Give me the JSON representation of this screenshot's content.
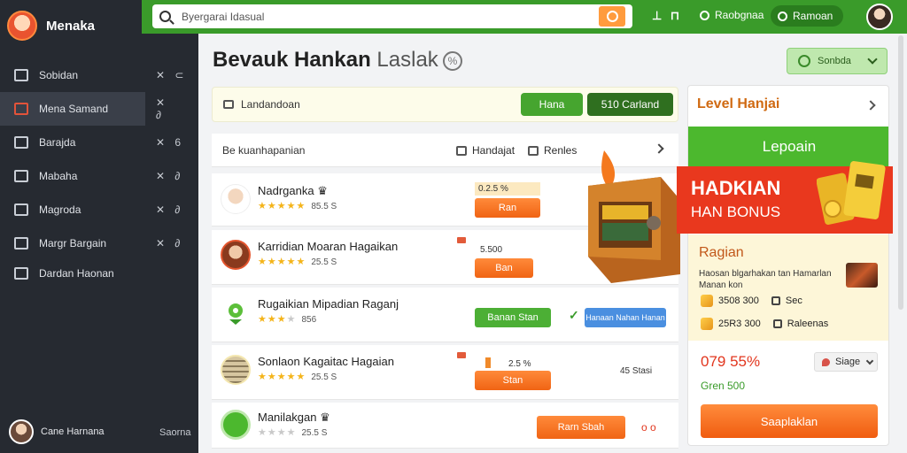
{
  "app": {
    "name": "Menaka"
  },
  "sidebar": {
    "items": [
      {
        "label": "Sobidan",
        "meta": "✕ ⊂",
        "active": false
      },
      {
        "label": "Mena Samand",
        "meta": "✕ ∂",
        "active": true
      },
      {
        "label": "Barajda",
        "meta": "✕ 6",
        "active": false
      },
      {
        "label": "Mabaha",
        "meta": "✕ ∂",
        "active": false
      },
      {
        "label": "Magroda",
        "meta": "✕ ∂",
        "active": false
      },
      {
        "label": "Margr Bargain",
        "meta": "✕ ∂",
        "active": false
      },
      {
        "label": "Dardan Haonan",
        "meta": "",
        "active": false
      }
    ],
    "user": {
      "name": "Cane Harnana",
      "meta": "Saorna"
    }
  },
  "topbar": {
    "search_value": "Byergarai Idasual",
    "mini": "⊥ ⊓",
    "link": "Raobgnaa",
    "pill": "Ramoan"
  },
  "main": {
    "title": "Bevauk Hankan",
    "title_suffix": "Laslak",
    "sort_label": "Sonbda",
    "filter_text": "Landandoan",
    "filter_btn1": "Hana",
    "filter_btn2": "510 Carland",
    "list_head": "Be kuanhapanian",
    "list_opt1": "Handajat",
    "list_opt2": "Renles",
    "rows": [
      {
        "name": "Nadrganka ♛",
        "score": "85.5 S",
        "pct": "0.2.5 %",
        "btn": "Ran"
      },
      {
        "name": "Karridian Moaran Hagaikan",
        "score": "25.5 S",
        "pct": "5.500",
        "btn": "Ban"
      },
      {
        "name": "Rugaikian Mipadian Raganj",
        "score": "856",
        "btn": "Banan Stan",
        "btn2": "Hanaan Nahan Hanan"
      },
      {
        "name": "Sonlaon Kagaitac Hagaian",
        "score": "25.5 S",
        "pct": "2.5 %",
        "btn": "Stan",
        "extra": "45 Stasi"
      },
      {
        "name": "Manilakgan ♛",
        "score": "25.5 S",
        "btn": "Rarn Sbah",
        "extra": "o o"
      }
    ]
  },
  "panel": {
    "title": "Level Hanjai",
    "green_label": "Lepoain",
    "bonus_line1": "HADKIAN",
    "bonus_line2": "HAN BONUS",
    "sub_title": "Ragian",
    "desc": "Haosan blgarhakan tan Hamarlan Manan kon",
    "stat1": "3508 300",
    "stat1b": "Sec",
    "stat2": "25R3 300",
    "stat2b": "Raleenas",
    "price": "079 55%",
    "sub_price": "Gren 500",
    "stage_label": "Siage",
    "cta": "Saaplaklan"
  }
}
